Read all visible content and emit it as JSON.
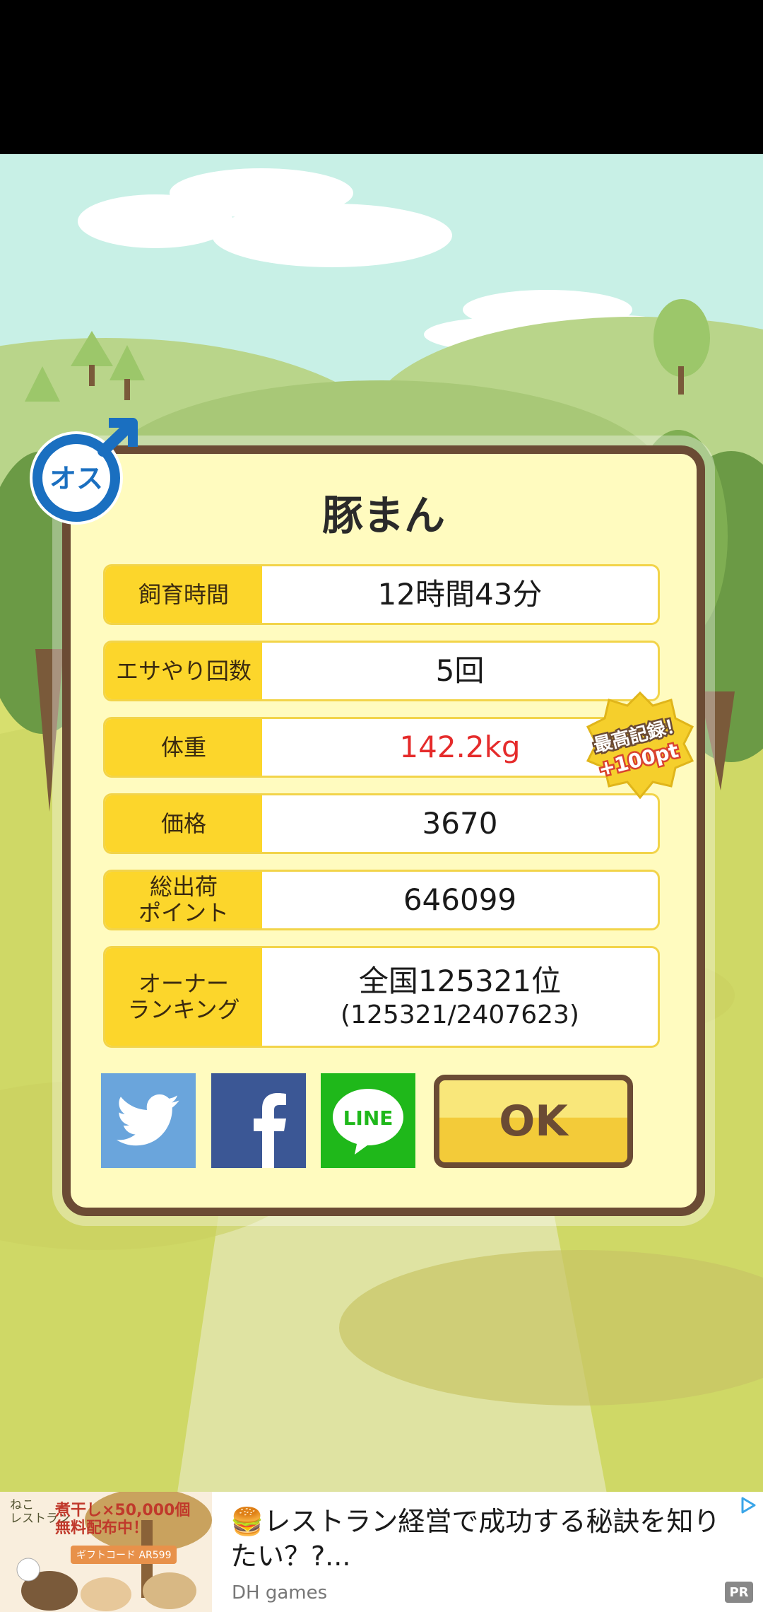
{
  "pig_name": "豚まん",
  "gender_badge": "オス",
  "stats": [
    {
      "label": "飼育時間",
      "value": "12時間43分"
    },
    {
      "label": "エサやり回数",
      "value": "5回"
    },
    {
      "label": "体重",
      "value": "142.2kg"
    },
    {
      "label": "価格",
      "value": "3670"
    },
    {
      "label": "総出荷\nポイント",
      "value": "646099"
    }
  ],
  "ranking": {
    "label": "オーナー\nランキング",
    "value": "全国125321位",
    "detail": "(125321/2407623)"
  },
  "record_badge": {
    "line1": "最高記録！",
    "line2": "+100pt"
  },
  "share": {
    "line_label": "LINE"
  },
  "ok_label": "OK",
  "ad": {
    "thumb_logo": "ねこ\nレストラン",
    "thumb_promo": "煮干し×50,000個\n無料配布中！",
    "thumb_code": "ギフトコード AR599",
    "headline": "🍔レストラン経営で成功する秘訣を知りたい？?...",
    "source": "DH games",
    "pr_label": "PR"
  },
  "colors": {
    "weight_value": "#e52b2b",
    "label_bg": "#fcd62b",
    "frame": "#6b4b34"
  }
}
